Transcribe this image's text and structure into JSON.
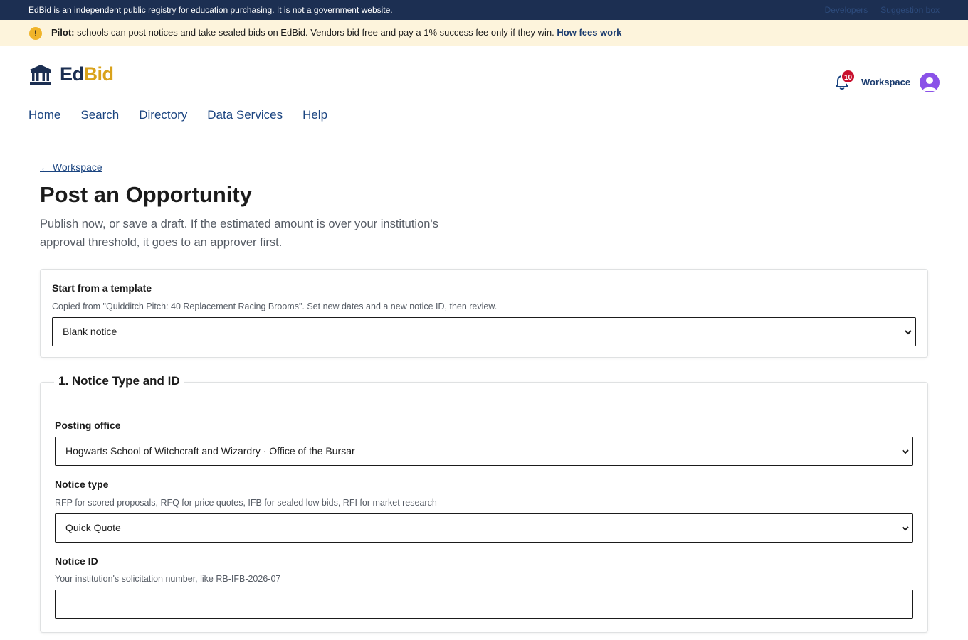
{
  "topbar": {
    "disclaimer": "EdBid is an independent public registry for education purchasing. It is not a government website.",
    "links": [
      "Developers",
      "Suggestion box"
    ]
  },
  "pilot": {
    "label": "Pilot:",
    "message": "schools can post notices and take sealed bids on EdBid. Vendors bid free and pay a 1% success fee only if they win.",
    "link": "How fees work"
  },
  "header": {
    "brand_ed": "Ed",
    "brand_bid": "Bid",
    "notification_count": "10",
    "workspace_link": "Workspace",
    "nav": [
      "Home",
      "Search",
      "Directory",
      "Data Services",
      "Help"
    ]
  },
  "page": {
    "back_link": "← Workspace",
    "title": "Post an Opportunity",
    "lede": "Publish now, or save a draft. If the estimated amount is over your institution's approval threshold, it goes to an approver first."
  },
  "template_card": {
    "label": "Start from a template",
    "hint": "Copied from \"Quidditch Pitch: 40 Replacement Racing Brooms\". Set new dates and a new notice ID, then review.",
    "selected": "Blank notice"
  },
  "section1": {
    "legend": "1. Notice Type and ID",
    "posting_office_label": "Posting office",
    "posting_office_value": "Hogwarts School of Witchcraft and Wizardry · Office of the Bursar",
    "notice_type_label": "Notice type",
    "notice_type_hint": "RFP for scored proposals, RFQ for price quotes, IFB for sealed low bids, RFI for market research",
    "notice_type_value": "Quick Quote",
    "notice_id_label": "Notice ID",
    "notice_id_hint": "Your institution's solicitation number, like RB-IFB-2026-07",
    "notice_id_value": ""
  },
  "colors": {
    "topbar_bg": "#1c2f52",
    "pilot_bg": "#fdf4dc",
    "brand_gold": "#d9a21b",
    "link_blue": "#1a4480",
    "badge_red": "#c8102e",
    "avatar_purple": "#8a52e8"
  },
  "icons": [
    "warning-icon",
    "institution-logo-icon",
    "bell-icon",
    "user-avatar-icon",
    "chevron-down-icon"
  ]
}
